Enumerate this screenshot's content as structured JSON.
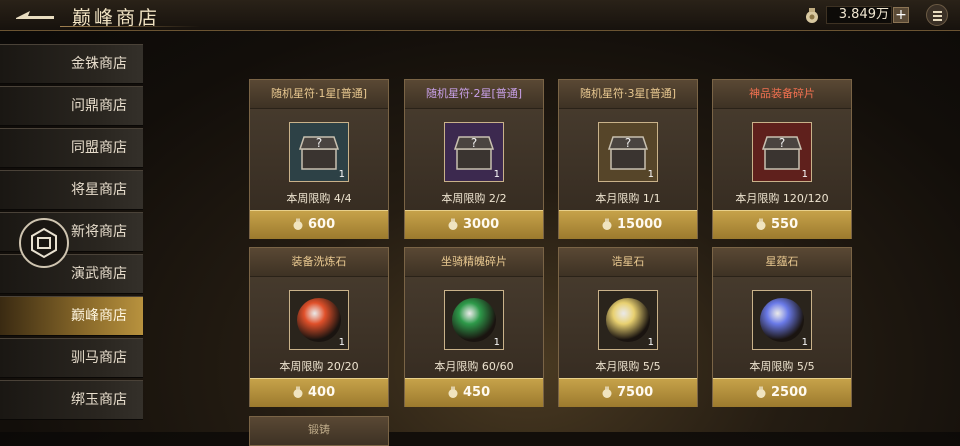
{
  "header": {
    "title": "巅峰商店",
    "currency": "3.849万"
  },
  "sidebar": {
    "items": [
      {
        "label": "金铢商店",
        "active": false
      },
      {
        "label": "问鼎商店",
        "active": false
      },
      {
        "label": "同盟商店",
        "active": false
      },
      {
        "label": "将星商店",
        "active": false
      },
      {
        "label": "新将商店",
        "active": false
      },
      {
        "label": "演武商店",
        "active": false
      },
      {
        "label": "巅峰商店",
        "active": true
      },
      {
        "label": "驯马商店",
        "active": false
      },
      {
        "label": "绑玉商店",
        "active": false
      }
    ]
  },
  "shop": {
    "items": [
      {
        "name": "随机星符·1星[普通]",
        "name_color": "#e8c890",
        "qty": "1",
        "limit": "本周限购 4/4",
        "price": "600",
        "icon": "chest-icon",
        "tint": "#2f5a6a"
      },
      {
        "name": "随机星符·2星[普通]",
        "name_color": "#c8a0e8",
        "qty": "1",
        "limit": "本周限购 2/2",
        "price": "3000",
        "icon": "chest-icon",
        "tint": "#4a2e7a"
      },
      {
        "name": "随机星符·3星[普通]",
        "name_color": "#e8c890",
        "qty": "1",
        "limit": "本月限购 1/1",
        "price": "15000",
        "icon": "chest-icon",
        "tint": "#7a6034"
      },
      {
        "name": "神品装备碎片",
        "name_color": "#f07050",
        "qty": "1",
        "limit": "本月限购 120/120",
        "price": "550",
        "icon": "chest-icon",
        "tint": "#8a1e1e"
      },
      {
        "name": "装备洗炼石",
        "name_color": "#e8c890",
        "qty": "1",
        "limit": "本周限购 20/20",
        "price": "400",
        "icon": "orb-icon",
        "tint": "#e0502a"
      },
      {
        "name": "坐骑精魄碎片",
        "name_color": "#e8c890",
        "qty": "1",
        "limit": "本月限购 60/60",
        "price": "450",
        "icon": "orb-icon",
        "tint": "#2e9a4a"
      },
      {
        "name": "诰星石",
        "name_color": "#e8c890",
        "qty": "1",
        "limit": "本月限购 5/5",
        "price": "7500",
        "icon": "orb-icon",
        "tint": "#e8d070"
      },
      {
        "name": "星蕴石",
        "name_color": "#e8c890",
        "qty": "1",
        "limit": "本周限购 5/5",
        "price": "2500",
        "icon": "orb-icon",
        "tint": "#6a7ae8"
      }
    ],
    "partial_item": "锻铸"
  }
}
